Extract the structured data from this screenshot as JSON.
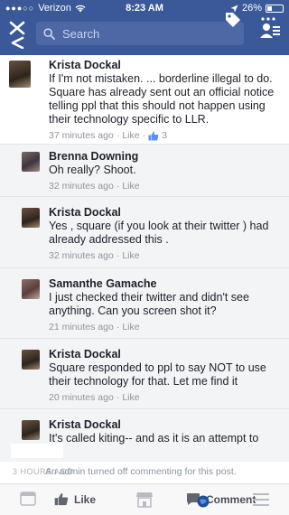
{
  "status": {
    "carrier": "Verizon",
    "time": "8:23 AM",
    "battery": "26%"
  },
  "search": {
    "placeholder": "Search"
  },
  "comments": [
    {
      "name": "Krista Dockal",
      "text": "If I'm not mistaken. ... borderline illegal to do. Square has already sent out an official notice telling ppl that this should not happen using their technology specific to LLR.",
      "time": "37 minutes ago",
      "like_label": "Like",
      "like_count": "3"
    },
    {
      "name": "Brenna Downing",
      "text": "Oh really? Shoot.",
      "time": "32 minutes ago",
      "like_label": "Like"
    },
    {
      "name": "Krista Dockal",
      "text": "Yes , square (if you look at their twitter ) had already addressed this .",
      "time": "32 minutes ago",
      "like_label": "Like"
    },
    {
      "name": "Samanthe Gamache",
      "text": "I just checked their twitter and didn't see anything. Can you screen shot it?",
      "time": "21 minutes ago",
      "like_label": "Like"
    },
    {
      "name": "Krista Dockal",
      "text": "Square responded to ppl to say NOT to use their technology for that.  Let me find it",
      "time": "20 minutes ago",
      "like_label": "Like"
    },
    {
      "name": "Krista Dockal",
      "text": "It's called kiting-- and as it is an attempt to"
    }
  ],
  "notice": {
    "hours": "3 HOURS AGO",
    "message": "An admin turned off commenting for this post."
  },
  "bottombar": {
    "like_label": "Like",
    "comment_label": "Comment"
  }
}
